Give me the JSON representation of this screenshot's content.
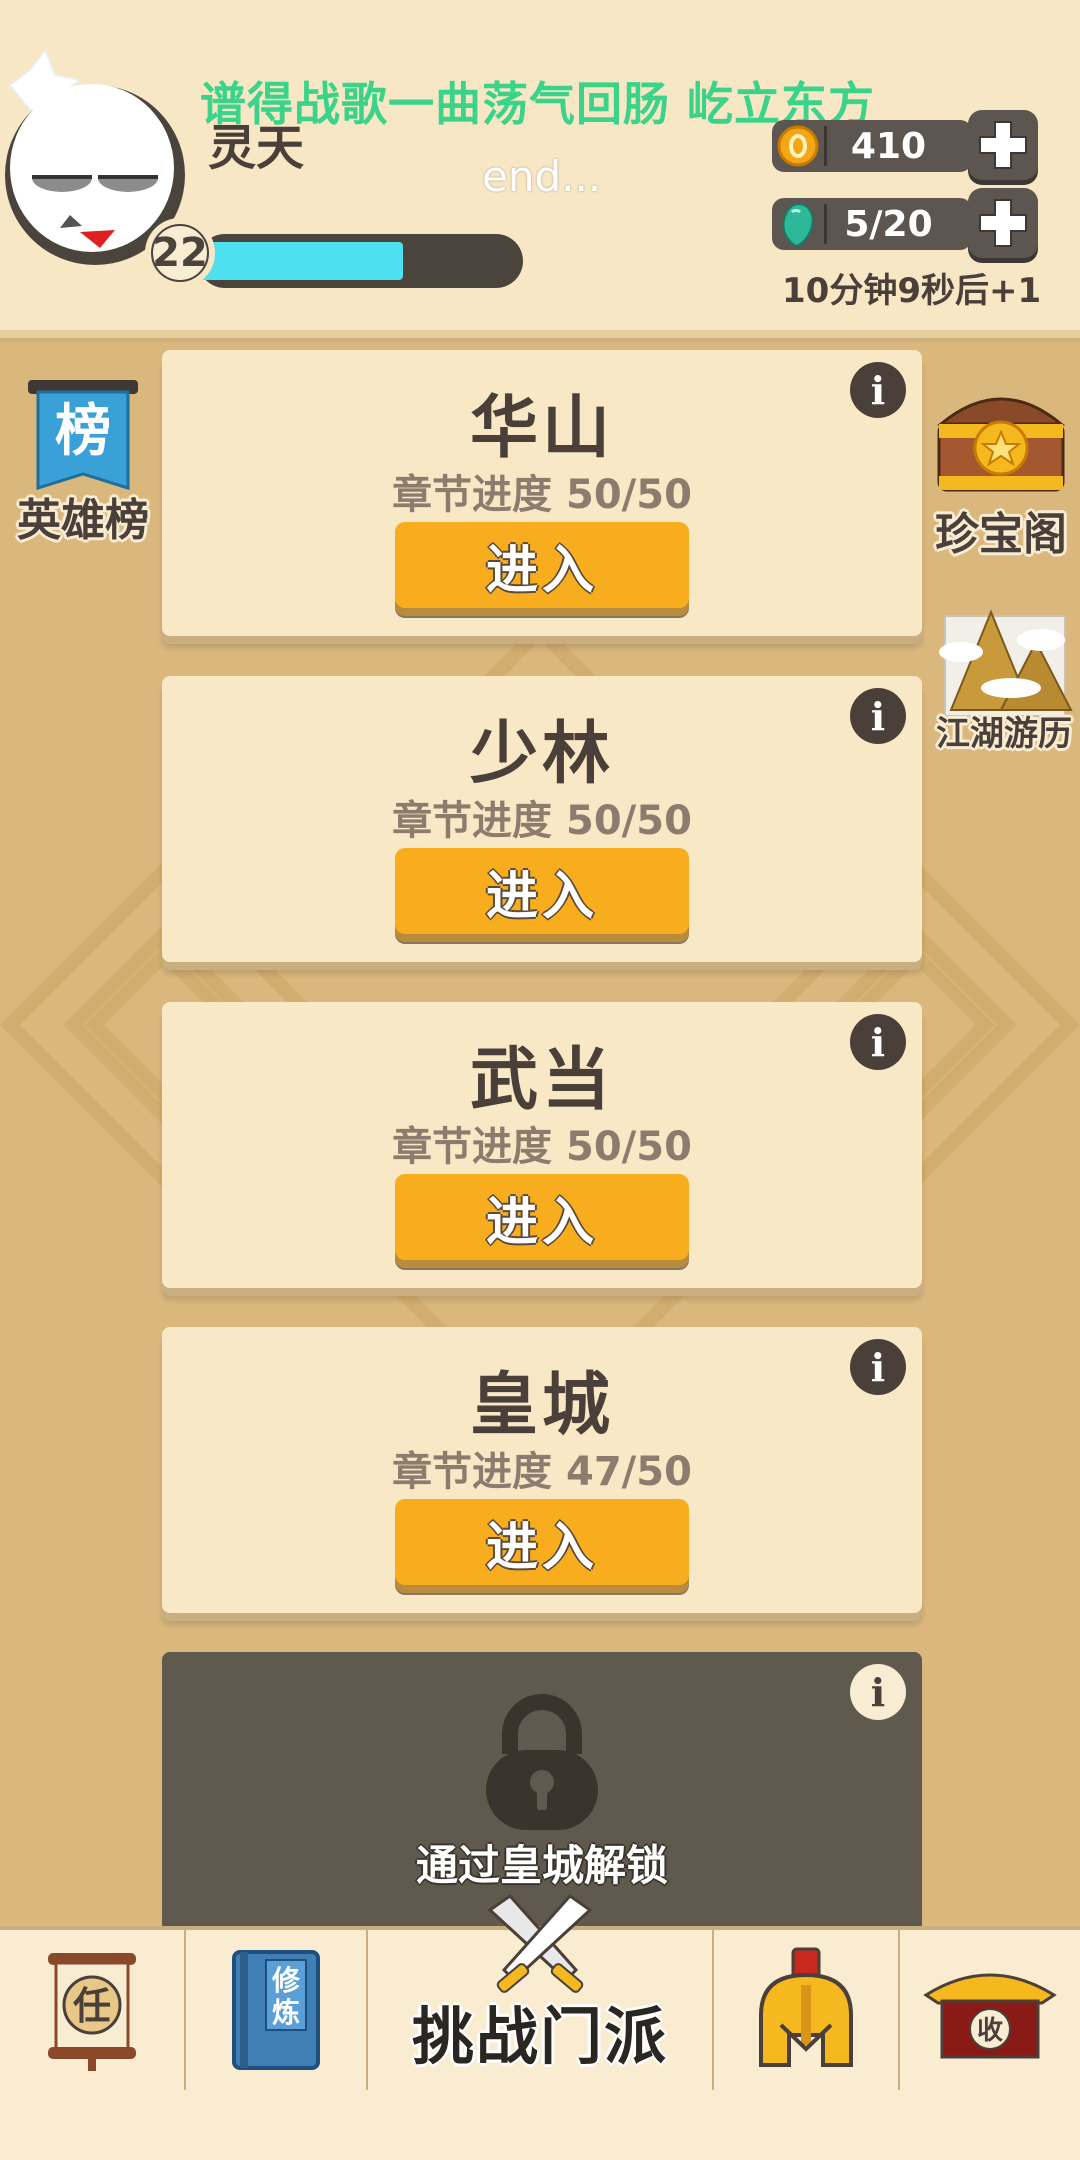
{
  "header": {
    "banner_text": "谱得战歌一曲荡气回肠 屹立东方",
    "player_name": "灵天",
    "status_text": "end...",
    "level": "22",
    "exp_progress": 0.65,
    "coins": "410",
    "stamina": "5/20",
    "stamina_timer": "10分钟9秒后+1"
  },
  "side_left": {
    "ranking_label": "英雄榜",
    "ranking_icon_char": "榜"
  },
  "side_right": {
    "treasure_label": "珍宝阁",
    "travel_label": "江湖游历"
  },
  "sects": [
    {
      "name": "华山",
      "progress": "章节进度 50/50",
      "enter_label": "进入",
      "info": "i"
    },
    {
      "name": "少林",
      "progress": "章节进度 50/50",
      "enter_label": "进入",
      "info": "i"
    },
    {
      "name": "武当",
      "progress": "章节进度 50/50",
      "enter_label": "进入",
      "info": "i"
    },
    {
      "name": "皇城",
      "progress": "章节进度 47/50",
      "enter_label": "进入",
      "info": "i"
    }
  ],
  "locked_sect": {
    "unlock_text": "通过皇城解锁",
    "info": "i"
  },
  "bottom_nav": {
    "task_char": "任",
    "cultivate_chars": [
      "修",
      "炼"
    ],
    "challenge_label": "挑战门派",
    "collect_char": "收"
  },
  "colors": {
    "background": "#d9b77d",
    "card": "#f8e8c6",
    "button": "#f8ad1e",
    "locked_card": "#605a4e",
    "exp_bar": "#4fe0f0",
    "banner_text": "#3bd38a"
  },
  "icons": [
    "avatar",
    "coin-icon",
    "gem-icon",
    "plus-icon",
    "ranking-banner-icon",
    "treasure-chest-icon",
    "mountain-icon",
    "info-icon",
    "lock-icon",
    "task-scroll-icon",
    "book-icon",
    "crossed-swords-icon",
    "helmet-icon",
    "house-icon"
  ]
}
